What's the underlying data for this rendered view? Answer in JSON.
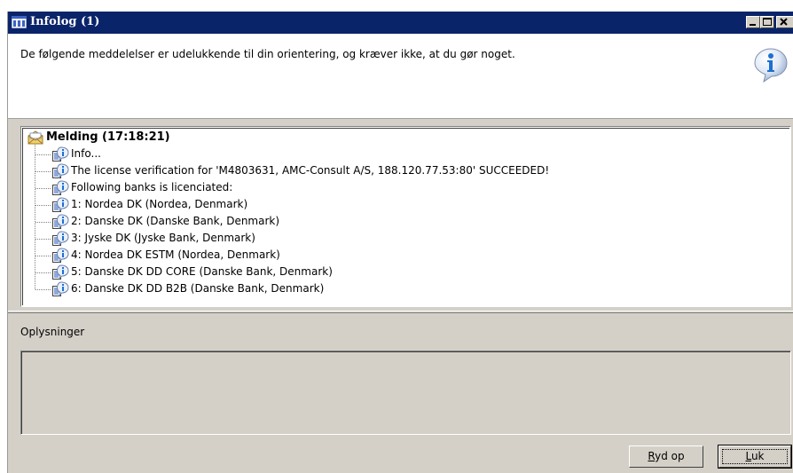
{
  "window": {
    "title": "Infolog (1)",
    "controls": {
      "minimize": "minimize-icon",
      "maximize": "maximize-icon",
      "close": "close-icon"
    }
  },
  "header": {
    "message": "De følgende meddelelser er udelukkende til din orientering, og kræver ikke, at du gør noget.",
    "icon": "info-icon"
  },
  "tree": {
    "root": {
      "label": "Melding (17:18:21)",
      "icon": "message-envelope-icon"
    },
    "items": [
      {
        "label": "Info...",
        "icon": "info-document-icon"
      },
      {
        "label": "The license verification for 'M4803631, AMC-Consult A/S, 188.120.77.53:80' SUCCEEDED!",
        "icon": "info-document-icon"
      },
      {
        "label": "Following banks is licenciated:",
        "icon": "info-document-icon"
      },
      {
        "label": "1: Nordea DK (Nordea, Denmark)",
        "icon": "info-document-icon"
      },
      {
        "label": "2: Danske DK (Danske Bank, Denmark)",
        "icon": "info-document-icon"
      },
      {
        "label": "3: Jyske DK (Jyske Bank, Denmark)",
        "icon": "info-document-icon"
      },
      {
        "label": "4: Nordea DK ESTM (Nordea, Denmark)",
        "icon": "info-document-icon"
      },
      {
        "label": "5: Danske DK DD CORE (Danske Bank, Denmark)",
        "icon": "info-document-icon"
      },
      {
        "label": "6: Danske DK DD B2B (Danske Bank, Denmark)",
        "icon": "info-document-icon"
      }
    ]
  },
  "details": {
    "label": "Oplysninger",
    "content": ""
  },
  "buttons": {
    "clear": "Ryd op",
    "close": "Luk"
  },
  "colors": {
    "titlebar": "#0a246a",
    "face": "#d4d0c8",
    "accent_info": "#1d6fd1"
  }
}
